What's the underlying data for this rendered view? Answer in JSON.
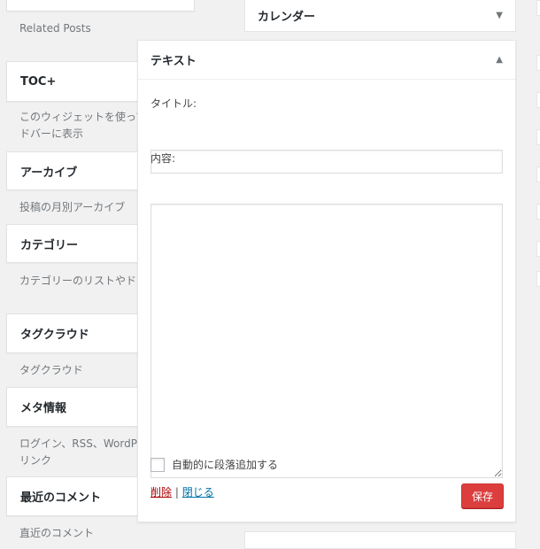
{
  "available_widgets": [
    {
      "id": "related-posts",
      "title": "",
      "desc": "Related Posts"
    },
    {
      "id": "toc",
      "title": "TOC+",
      "desc": "このウィジェットを使って目\nドバーに表示"
    },
    {
      "id": "archives",
      "title": "アーカイブ",
      "desc": "投稿の月別アーカイブ"
    },
    {
      "id": "categories",
      "title": "カテゴリー",
      "desc": "カテゴリーのリストやドロッ"
    },
    {
      "id": "tag-cloud",
      "title": "タグクラウド",
      "desc": "タグクラウド"
    },
    {
      "id": "meta",
      "title": "メタ情報",
      "desc": "ログイン、RSS、WordPress\nリンク"
    },
    {
      "id": "recent-comments",
      "title": "最近のコメント",
      "desc": "直近のコメント"
    }
  ],
  "sidebar": {
    "calendar_title": "カレンダー",
    "collapse_arrow": "▼",
    "expand_arrow": "▲"
  },
  "text_widget": {
    "header_title": "テキスト",
    "title_label": "タイトル:",
    "title_value": "",
    "content_label": "内容:",
    "content_value": "",
    "auto_paragraph_label": "自動的に段落追加する",
    "auto_paragraph_checked": false,
    "delete_label": "削除",
    "separator": "|",
    "close_label": "閉じる",
    "save_label": "保存"
  }
}
